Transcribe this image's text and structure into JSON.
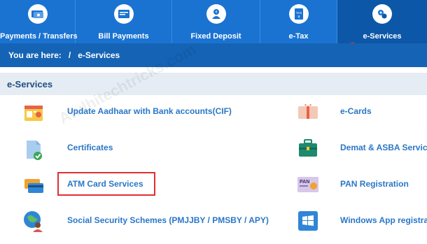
{
  "nav": {
    "tabs": [
      {
        "label": "Payments / Transfers",
        "icon": "payments-icon"
      },
      {
        "label": "Bill Payments",
        "icon": "bill-icon"
      },
      {
        "label": "Fixed Deposit",
        "icon": "deposit-icon"
      },
      {
        "label": "e-Tax",
        "icon": "tax-icon"
      },
      {
        "label": "e-Services",
        "icon": "eservices-icon",
        "active": true
      }
    ]
  },
  "breadcrumb": {
    "prefix": "You are here:",
    "sep": "/",
    "current": "e-Services"
  },
  "section": {
    "title": "e-Services"
  },
  "services_left": [
    {
      "label": "Update Aadhaar with Bank accounts(CIF)",
      "icon": "aadhaar-card-icon"
    },
    {
      "label": "Certificates",
      "icon": "certificate-icon"
    },
    {
      "label": "ATM Card Services",
      "icon": "atm-card-icon"
    },
    {
      "label": "Social Security Schemes (PMJJBY / PMSBY / APY)",
      "icon": "social-security-icon"
    }
  ],
  "services_right": [
    {
      "label": "e-Cards",
      "icon": "gift-card-icon"
    },
    {
      "label": "Demat & ASBA Services",
      "icon": "briefcase-icon"
    },
    {
      "label": "PAN Registration",
      "icon": "pan-card-icon"
    },
    {
      "label": "Windows App registration",
      "icon": "windows-icon"
    }
  ],
  "watermark": "Atulhitechtricks.com",
  "colors": {
    "nav": "#1a73d1",
    "nav_active": "#0d57a8",
    "breadcrumb": "#1563b5",
    "link": "#2a77c7",
    "highlight": "#e03030"
  }
}
